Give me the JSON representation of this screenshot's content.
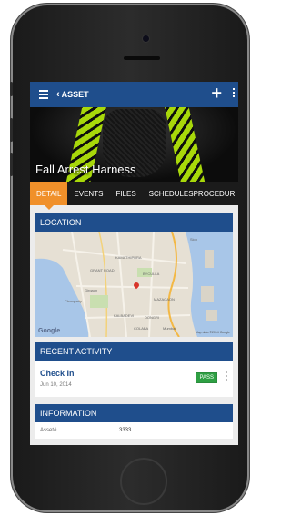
{
  "appbar": {
    "title": "ASSET"
  },
  "hero": {
    "title": "Fall Arrest Harness"
  },
  "tabs": [
    {
      "label": "DETAIL"
    },
    {
      "label": "EVENTS"
    },
    {
      "label": "FILES"
    },
    {
      "label": "SCHEDULES"
    },
    {
      "label": "PROCEDUR"
    }
  ],
  "location": {
    "header": "LOCATION",
    "map": {
      "brand": "Google",
      "copyright": "Map data ©2014 Google",
      "labels": [
        "Sion",
        "KAMATHIPURA",
        "BYCULLA",
        "GRANT ROAD",
        "MAZAGAON",
        "Chowpatty",
        "KALBADEVI",
        "COLABA",
        "DONGRI",
        "Girgaon",
        "Mumbai"
      ]
    }
  },
  "recent_activity": {
    "header": "RECENT ACTIVITY",
    "items": [
      {
        "title": "Check In",
        "date": "Jun 10, 2014",
        "status": "PASS"
      }
    ]
  },
  "information": {
    "header": "INFORMATION",
    "rows": [
      {
        "label": "Asset#",
        "value": "3333"
      }
    ]
  },
  "colors": {
    "primary": "#1f4e8c",
    "accent": "#f0902a",
    "pass": "#2ea043"
  }
}
